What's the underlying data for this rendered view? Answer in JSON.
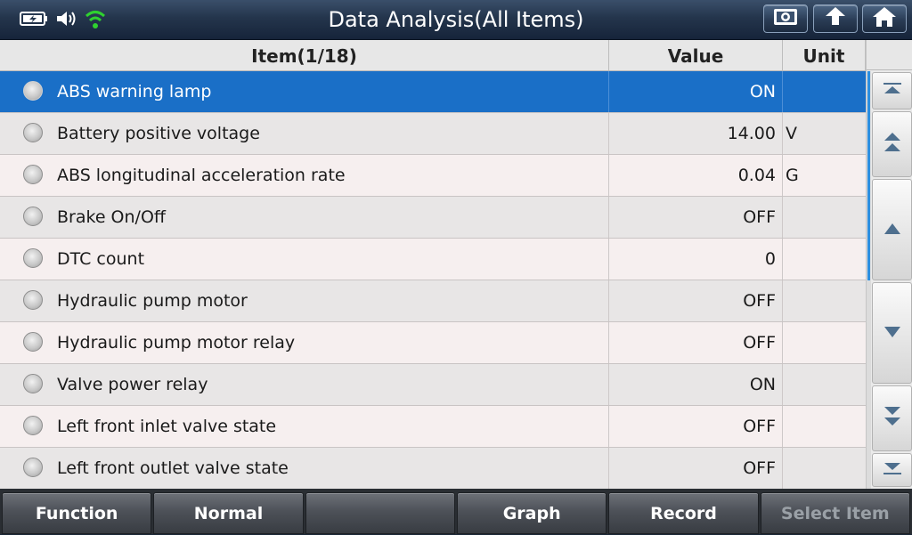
{
  "header": {
    "title": "Data Analysis(All Items)",
    "status_icons": [
      "battery-charging-icon",
      "speaker-icon",
      "wifi-icon"
    ],
    "buttons": [
      "screenshot-icon",
      "back-arrow-icon",
      "home-icon"
    ]
  },
  "table": {
    "columns": {
      "item": "Item(1/18)",
      "value": "Value",
      "unit": "Unit"
    },
    "rows": [
      {
        "item": "ABS warning lamp",
        "value": "ON",
        "unit": ""
      },
      {
        "item": "Battery positive voltage",
        "value": "14.00",
        "unit": "V"
      },
      {
        "item": "ABS longitudinal acceleration rate",
        "value": "0.04",
        "unit": "G"
      },
      {
        "item": "Brake On/Off",
        "value": "OFF",
        "unit": ""
      },
      {
        "item": "DTC count",
        "value": "0",
        "unit": ""
      },
      {
        "item": "Hydraulic pump motor",
        "value": "OFF",
        "unit": ""
      },
      {
        "item": "Hydraulic pump motor relay",
        "value": "OFF",
        "unit": ""
      },
      {
        "item": "Valve power relay",
        "value": "ON",
        "unit": ""
      },
      {
        "item": "Left front inlet valve state",
        "value": "OFF",
        "unit": ""
      },
      {
        "item": "Left front outlet valve state",
        "value": "OFF",
        "unit": ""
      }
    ],
    "selected_row": 0
  },
  "scroll_position": 0,
  "footer": {
    "function": "Function",
    "normal": "Normal",
    "empty": "",
    "graph": "Graph",
    "record": "Record",
    "select_item": "Select Item"
  },
  "colors": {
    "selected_row": "#1a6fc7",
    "scroll_thumb": "#2d8fe0",
    "wifi": "#2fd12f"
  }
}
